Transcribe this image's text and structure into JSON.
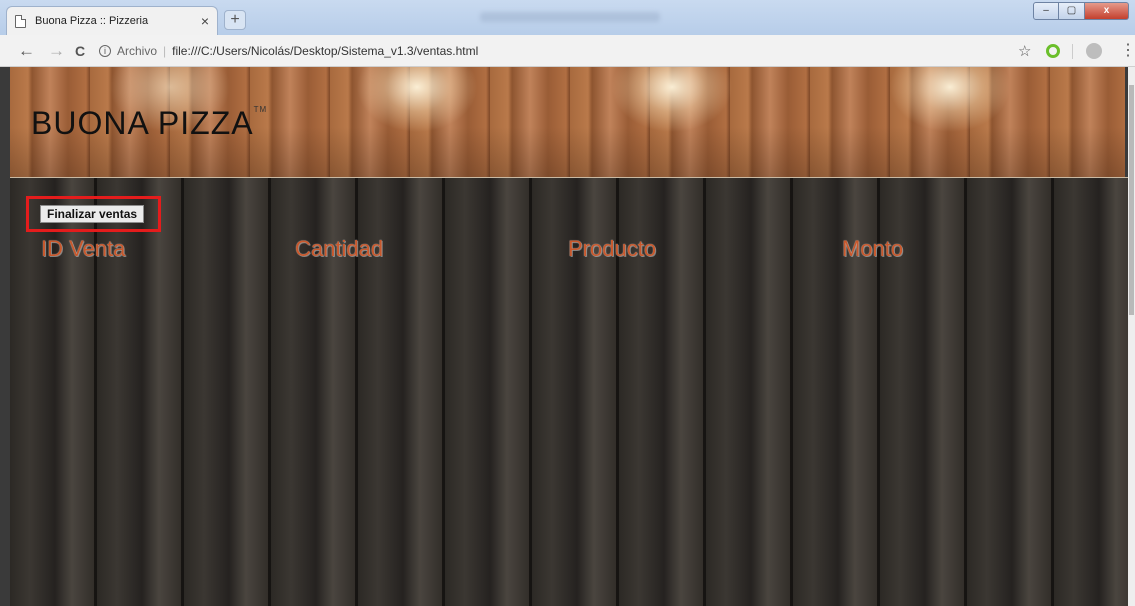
{
  "browser": {
    "tab_title": "Buona Pizza :: Pizzeria",
    "tab_close": "×",
    "new_tab": "+",
    "address_scheme": "Archivo",
    "address_url": "file:///C:/Users/Nicolás/Desktop/Sistema_v1.3/ventas.html",
    "nav": {
      "back": "←",
      "forward": "→",
      "reload": "C"
    },
    "star": "☆",
    "menu": "⋮",
    "win_min": "–",
    "win_max": "▢",
    "win_close": "x"
  },
  "header": {
    "brand": "BUONA PIZZA",
    "brand_mark": "TM"
  },
  "main": {
    "finalizar_label": "Finalizar ventas",
    "columns": [
      "ID Venta",
      "Cantidad",
      "Producto",
      "Monto"
    ]
  },
  "colors": {
    "highlight_border": "#e41c1c",
    "column_header": "#c8582c"
  }
}
